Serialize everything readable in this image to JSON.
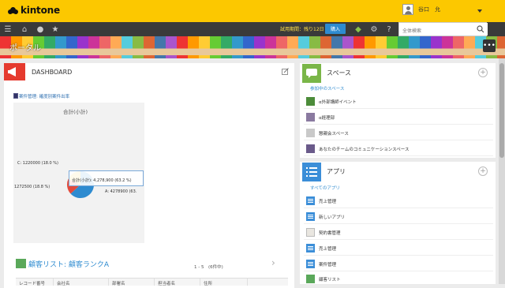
{
  "topbar": {
    "logo_text": "kintone",
    "user_name": "谷口　允"
  },
  "navbar": {
    "trial_text": "試用期間：残り12日",
    "buy_label": "購入",
    "search_placeholder": "全体検索"
  },
  "portal": {
    "title": "ポータル",
    "more": "•••"
  },
  "dashboard": {
    "title": "DASHBOARD",
    "report_link": "案件管理: 確度別案件出率",
    "chart_data": {
      "type": "pie",
      "title": "合計(小計)",
      "slices": [
        {
          "label": "A",
          "value": 4278900,
          "percent": 63.2,
          "color": "#2e8bd0"
        },
        {
          "label": "B",
          "value": 1272500,
          "percent": 18.8,
          "color": "#e34b3c"
        },
        {
          "label": "C",
          "value": 1220000,
          "percent": 18.0,
          "color": "#f0ca3a"
        }
      ],
      "labels": {
        "c": "C: 1220000 (18.0 %)",
        "b": "1272500 (18.8 %)",
        "a": "A: 4278900 (63.",
        "tooltip_key": "合計(小計)",
        "tooltip_val": ": 4,278,900 (63.2 %)"
      }
    }
  },
  "customer_list": {
    "title": "顧客リスト: 顧客ランクA",
    "count": "1 - 5　(6件中)",
    "columns": [
      "レコード番号",
      "会社名",
      "部署名",
      "担当者名",
      "住所"
    ]
  },
  "spaces": {
    "title": "スペース",
    "subhead": "参加中のスペース",
    "items": [
      "α外部講師イベント",
      "α経理部",
      "懇親会スペース",
      "あなたのチームのコミュニケーションスペース"
    ]
  },
  "apps": {
    "title": "アプリ",
    "subhead": "すべてのアプリ",
    "items": [
      "売上管理",
      "新しいアプリ",
      "契約書管理",
      "売上管理",
      "案件管理",
      "顧客リスト"
    ]
  }
}
